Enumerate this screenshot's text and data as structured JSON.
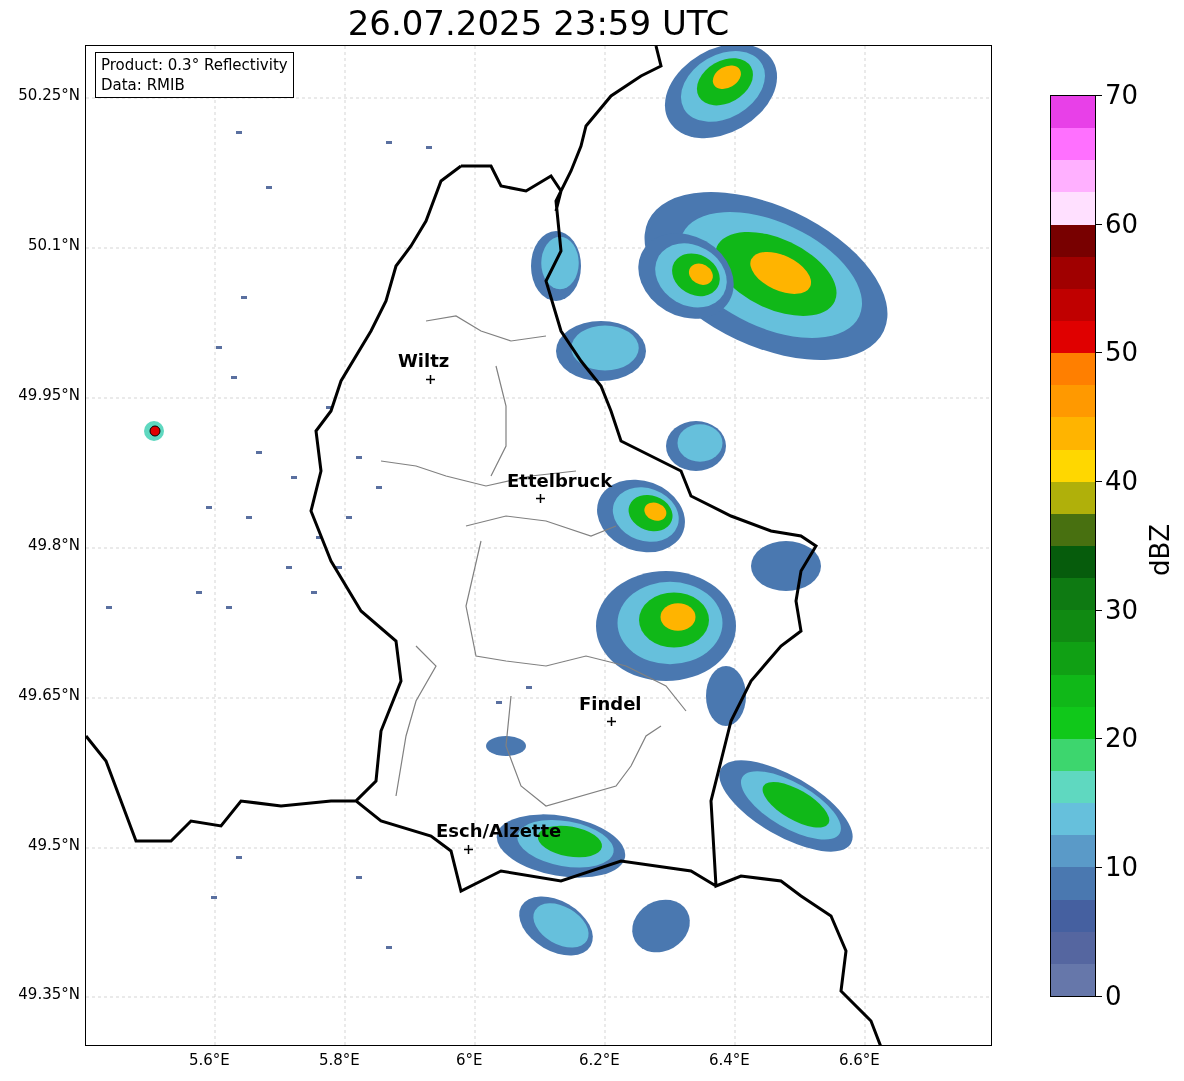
{
  "title": "26.07.2025 23:59 UTC",
  "info_box": [
    "Product: 0.3° Reflectivity",
    "Data: RMIB"
  ],
  "y_axis_labels": [
    "50.25°N",
    "50.1°N",
    "49.95°N",
    "49.8°N",
    "49.65°N",
    "49.5°N",
    "49.35°N"
  ],
  "x_axis_labels": [
    "5.6°E",
    "5.8°E",
    "6°E",
    "6.2°E",
    "6.4°E",
    "6.6°E"
  ],
  "places": [
    {
      "name": "Wiltz"
    },
    {
      "name": "Ettelbruck"
    },
    {
      "name": "Findel"
    },
    {
      "name": "Esch/Alzette"
    }
  ],
  "colorbar": {
    "label": "dBZ",
    "ticks": [
      "70",
      "60",
      "50",
      "40",
      "30",
      "20",
      "10",
      "0"
    ],
    "levels": [
      {
        "color": "#e840e8"
      },
      {
        "color": "#ff70ff"
      },
      {
        "color": "#ffb0ff"
      },
      {
        "color": "#ffe0ff"
      },
      {
        "color": "#780000"
      },
      {
        "color": "#a00000"
      },
      {
        "color": "#c00000"
      },
      {
        "color": "#e00000"
      },
      {
        "color": "#ff7f00"
      },
      {
        "color": "#ff9900"
      },
      {
        "color": "#ffb400"
      },
      {
        "color": "#ffd700"
      },
      {
        "color": "#b0b00a"
      },
      {
        "color": "#487010"
      },
      {
        "color": "#065c0c"
      },
      {
        "color": "#0e7a12"
      },
      {
        "color": "#108a12"
      },
      {
        "color": "#10a014"
      },
      {
        "color": "#10b818"
      },
      {
        "color": "#10c81a"
      },
      {
        "color": "#3dd66e"
      },
      {
        "color": "#5fd8c0"
      },
      {
        "color": "#66c0dc"
      },
      {
        "color": "#5a9ac8"
      },
      {
        "color": "#4a78b0"
      },
      {
        "color": "#4560a0"
      },
      {
        "color": "#5566a0"
      },
      {
        "color": "#6677aa"
      }
    ]
  }
}
